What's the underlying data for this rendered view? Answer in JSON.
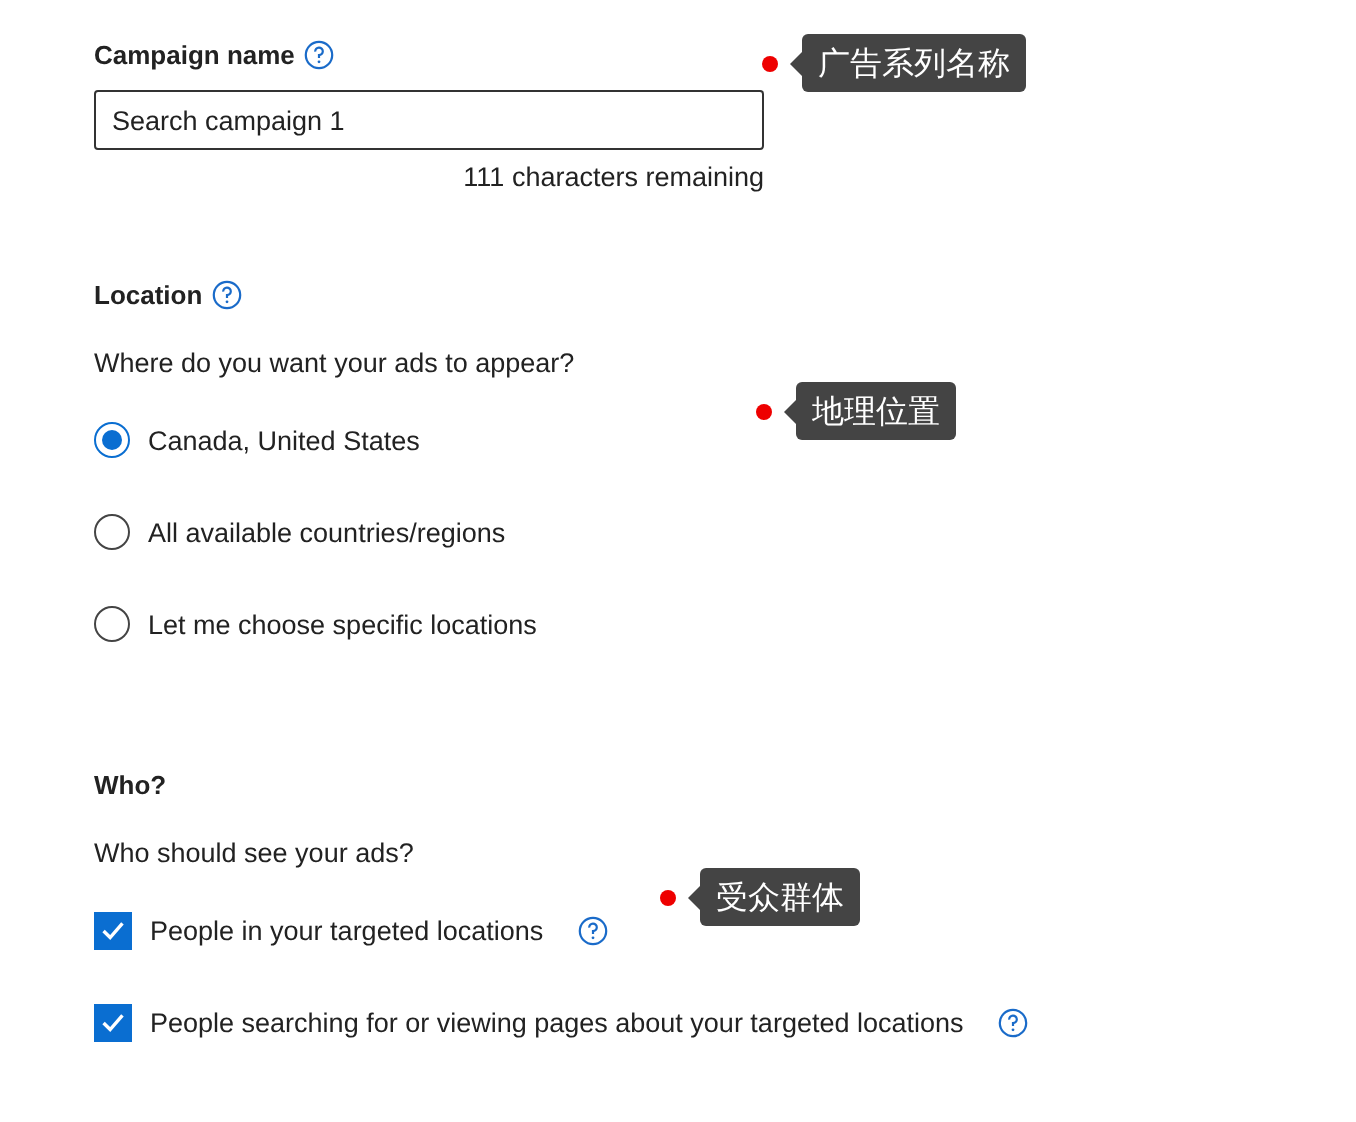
{
  "campaign_name": {
    "label": "Campaign name",
    "value": "Search campaign 1",
    "remaining": "111 characters remaining"
  },
  "location": {
    "label": "Location",
    "question": "Where do you want your ads to appear?",
    "options": [
      {
        "label": "Canada, United States",
        "selected": true
      },
      {
        "label": "All available countries/regions",
        "selected": false
      },
      {
        "label": "Let me choose specific locations",
        "selected": false
      }
    ]
  },
  "who": {
    "label": "Who?",
    "question": "Who should see your ads?",
    "options": [
      {
        "label": "People in your targeted locations",
        "checked": true
      },
      {
        "label": "People searching for or viewing pages about your targeted locations",
        "checked": true
      }
    ]
  },
  "annotations": [
    {
      "text": "广告系列名称"
    },
    {
      "text": "地理位置"
    },
    {
      "text": "受众群体"
    }
  ]
}
